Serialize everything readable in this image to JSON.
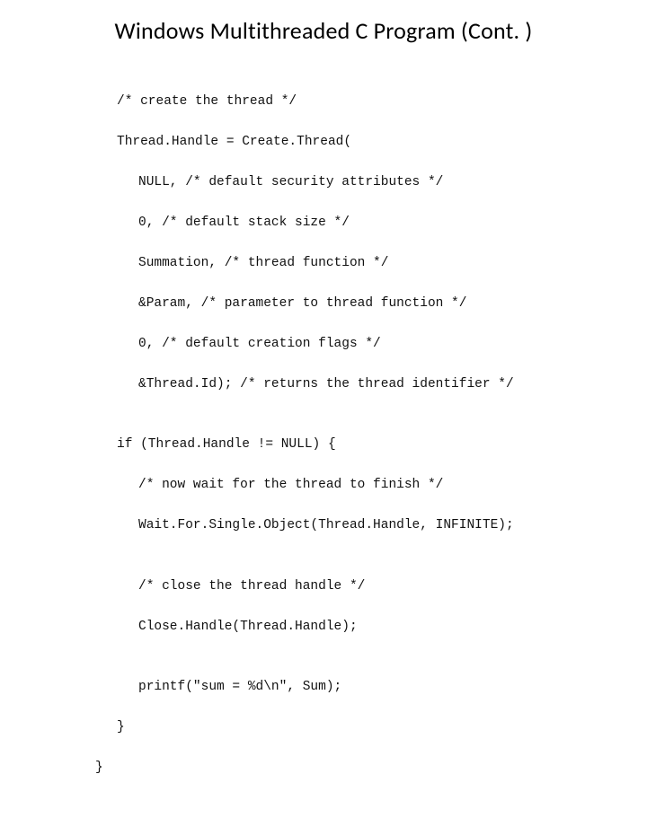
{
  "title": "Windows  Multithreaded C Program (Cont. )",
  "code": {
    "l01": "/* create the thread */",
    "l02": "Thread.Handle = Create.Thread(",
    "l03": "NULL, /* default security attributes */",
    "l04": "0, /* default stack size */",
    "l05": "Summation, /* thread function */",
    "l06": "&Param, /* parameter to thread function */",
    "l07": "0, /* default creation flags */",
    "l08": "&Thread.Id); /* returns the thread identifier */",
    "l09": "if (Thread.Handle != NULL) {",
    "l10": "/* now wait for the thread to finish */",
    "l11": "Wait.For.Single.Object(Thread.Handle, INFINITE);",
    "l12": "/* close the thread handle */",
    "l13": "Close.Handle(Thread.Handle);",
    "l14": "printf(\"sum = %d\\n\", Sum);",
    "l15": "}",
    "l16": "}"
  }
}
